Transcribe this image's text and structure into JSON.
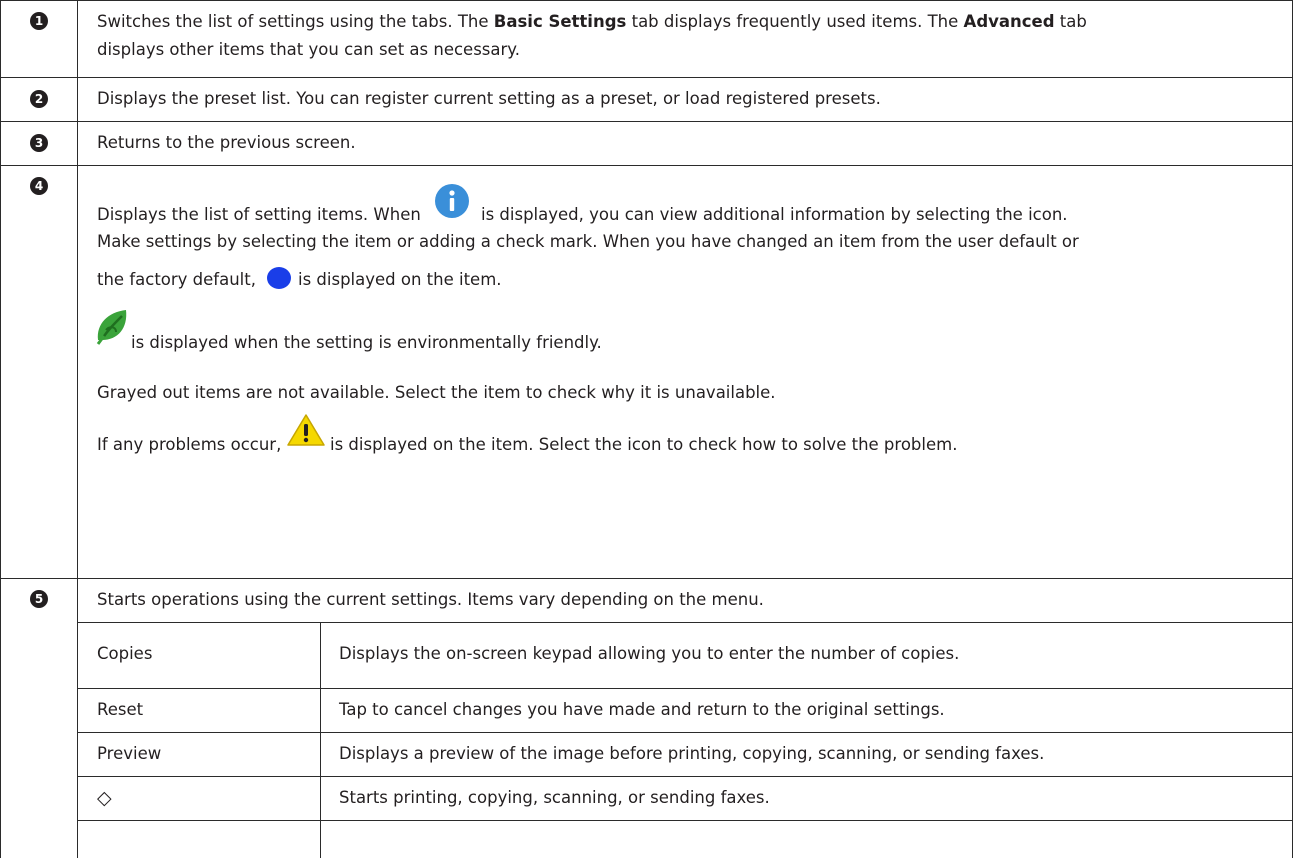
{
  "rows": [
    {
      "number": "1",
      "text_parts": [
        "Switches the list of settings using the tabs. The ",
        "Basic Settings",
        " tab displays frequently used items. The ",
        "Advanced",
        " tab",
        "displays other items that you can set as necessary."
      ]
    },
    {
      "number": "2",
      "text": "Displays the preset list. You can register current setting as a preset, or load registered presets."
    },
    {
      "number": "3",
      "text": "Returns to the previous screen."
    },
    {
      "number": "4",
      "text_parts": [
        "Displays the list of setting items. When",
        "is displayed, you can view additional information by selecting the icon.",
        "Make settings by selecting the item or adding a check mark. When you have changed an item from the user default or",
        "the factory default,",
        "is displayed on the item.",
        "is displayed when the setting is environmentally friendly.",
        "Grayed out items are not available. Select the item to check why it is unavailable.",
        "If any problems occur,",
        "is displayed on the item. Select the icon to check how to solve the problem."
      ],
      "icons": [
        "info-icon",
        "changed-dot-icon",
        "eco-leaf-icon",
        "warning-icon"
      ]
    },
    {
      "number": "5",
      "text": "Starts operations using the current settings. Items vary depending on the menu.",
      "subtable": [
        {
          "item": "Copies",
          "desc": "Displays the on-screen keypad allowing you to enter the number of copies."
        },
        {
          "item": "Reset",
          "desc": "Tap to cancel changes you have made and return to the original settings."
        },
        {
          "item": "Preview",
          "desc": "Displays a preview of the image before printing, copying, scanning, or sending faxes."
        },
        {
          "item": "◇",
          "desc": "Starts printing, copying, scanning, or sending faxes."
        }
      ]
    }
  ],
  "colors": {
    "text": "#231f20",
    "border": "#2b2b2b",
    "info_blue": "#3a8fd9",
    "dot_blue": "#1a3ee8",
    "leaf_green": "#3aa33a",
    "warning_yellow": "#f5d800"
  }
}
